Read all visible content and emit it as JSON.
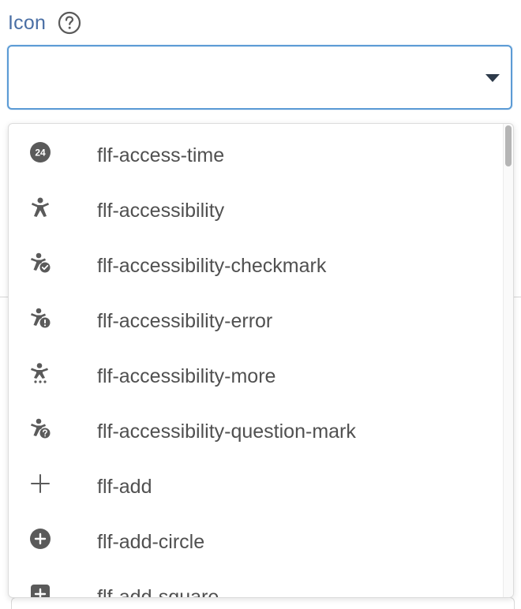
{
  "field": {
    "label": "Icon",
    "help_icon": "help-circle-icon",
    "value": "",
    "caret_icon": "caret-down-icon"
  },
  "dropdown": {
    "options": [
      {
        "label": "flf-access-time",
        "icon": "access-time-icon"
      },
      {
        "label": "flf-accessibility",
        "icon": "accessibility-icon"
      },
      {
        "label": "flf-accessibility-checkmark",
        "icon": "accessibility-checkmark-icon"
      },
      {
        "label": "flf-accessibility-error",
        "icon": "accessibility-error-icon"
      },
      {
        "label": "flf-accessibility-more",
        "icon": "accessibility-more-icon"
      },
      {
        "label": "flf-accessibility-question-mark",
        "icon": "accessibility-question-mark-icon"
      },
      {
        "label": "flf-add",
        "icon": "add-icon"
      },
      {
        "label": "flf-add-circle",
        "icon": "add-circle-icon"
      },
      {
        "label": "flf-add-square",
        "icon": "add-square-icon"
      }
    ]
  },
  "colors": {
    "label": "#4a6fa5",
    "focus_border": "#5b9bd5",
    "icon": "#5a5a5a",
    "option_text": "#505050"
  }
}
